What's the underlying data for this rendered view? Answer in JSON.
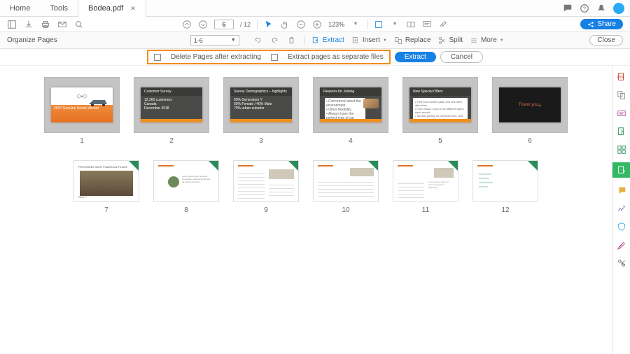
{
  "tabs": {
    "home": "Home",
    "tools": "Tools",
    "file": "Bodea.pdf"
  },
  "toolbar": {
    "page_current": "6",
    "page_total": "/ 12",
    "zoom": "123%",
    "share": "Share"
  },
  "organize": {
    "title": "Organize Pages",
    "range": "1-6",
    "extract": "Extract",
    "insert": "Insert",
    "replace": "Replace",
    "split": "Split",
    "more": "More",
    "close": "Close"
  },
  "extract_bar": {
    "delete_after": "Delete Pages after extracting",
    "separate": "Extract pages as separate files",
    "extract_btn": "Extract",
    "cancel_btn": "Cancel"
  },
  "pages_row1": [
    "1",
    "2",
    "3",
    "4",
    "5",
    "6"
  ],
  "pages_row2": [
    "7",
    "8",
    "9",
    "10",
    "11",
    "12"
  ],
  "slides": {
    "s2_title": "Customer Survey",
    "s2_l1": "12,300 customers",
    "s2_l2": "Canada",
    "s2_l3": "December 2018",
    "s3_title": "Survey Demographics – highlights",
    "s4_title": "Reasons for Joining",
    "s5_title": "New Special Offers",
    "s6_text": "Thank you",
    "s1_tag": "2017 Genuine Series Winner"
  },
  "row2_slide7_label": "Slide 7",
  "rail_colors": [
    "#c0392b",
    "#7d7d7d",
    "#b34aa0",
    "#2a8c5a",
    "#2a8c5a",
    "#33b864",
    "#e2b13c",
    "#2aa9f5",
    "#2aa9f5",
    "#b84a8a",
    "#555"
  ]
}
